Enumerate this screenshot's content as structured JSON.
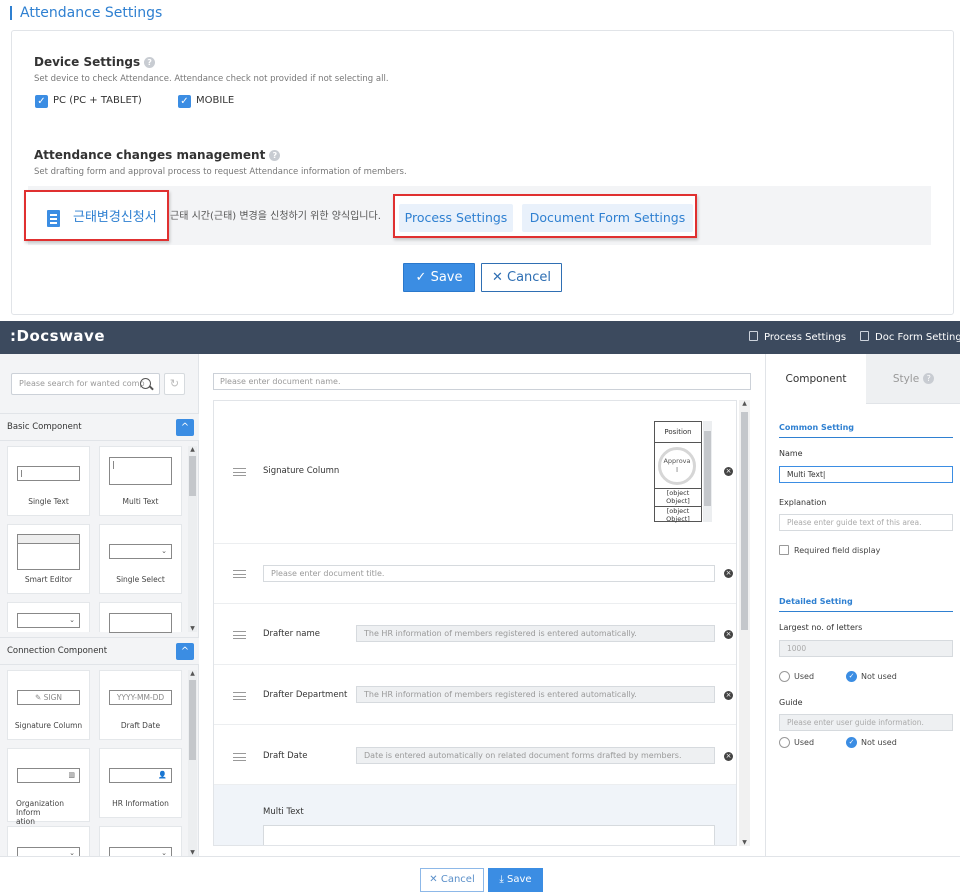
{
  "attendance": {
    "title": "Attendance Settings",
    "device": {
      "title": "Device Settings",
      "help": "?",
      "desc": "Set device to check Attendance. Attendance check not provided if not selecting all.",
      "options": [
        {
          "label": "PC (PC + TABLET)",
          "checked": true
        },
        {
          "label": "MOBILE",
          "checked": true
        }
      ]
    },
    "changes": {
      "title": "Attendance changes management",
      "help": "?",
      "desc": "Set drafting form and approval process to request Attendance information of members.",
      "form_name": "근태변경신청서",
      "form_desc": "근태 시간(근태) 변경을 신청하기 위한 양식입니다.",
      "process_settings": "Process Settings",
      "document_form_settings": "Document Form Settings"
    },
    "save_label": "Save",
    "cancel_label": "Cancel",
    "check_glyph": "✓",
    "x_glyph": "✕"
  },
  "docswave": {
    "logo": ":Docswave",
    "nav": {
      "process_settings": "Process Settings",
      "doc_form_settings": "Doc Form Settings"
    },
    "left": {
      "search_placeholder": "Please search for wanted comp",
      "refresh_glyph": "↻",
      "collapse_glyph": "^",
      "basic_group": "Basic Component",
      "basic_items": [
        "Single Text",
        "Multi Text",
        "Smart Editor",
        "Single Select"
      ],
      "connection_group": "Connection Component",
      "connection_items": [
        "Signature Column",
        "Draft Date",
        "Organization Inform\nation",
        "HR Information"
      ],
      "sign_text": "SIGN",
      "date_text": "YYYY-MM-DD"
    },
    "center": {
      "docname_placeholder": "Please enter document name.",
      "rows": {
        "signature": "Signature Column",
        "title_placeholder": "Please enter document title.",
        "drafter_name": "Drafter name",
        "drafter_name_value": "The HR information of members registered is entered automatically.",
        "drafter_dept": "Drafter Department",
        "drafter_dept_value": "The HR information of members registered is entered automatically.",
        "draft_date": "Draft Date",
        "draft_date_value": "Date is entered automatically on related document forms drafted by members.",
        "multi_text": "Multi Text"
      },
      "sig": {
        "position": "Position",
        "approval": "Approva\nl",
        "obj1": "[object\nObject]",
        "obj2": "[object\nObject]"
      },
      "delete_glyph": "×"
    },
    "right": {
      "tab_component": "Component",
      "tab_style": "Style",
      "common_setting": "Common Setting",
      "name_label": "Name",
      "name_value": "Multi Text",
      "explanation_label": "Explanation",
      "explanation_placeholder": "Please enter guide text of this area.",
      "required_label": "Required field display",
      "detailed_setting": "Detailed Setting",
      "largest_label": "Largest no. of letters",
      "largest_value": "1000",
      "used": "Used",
      "not_used": "Not used",
      "guide_label": "Guide",
      "guide_placeholder": "Please enter user guide information."
    },
    "bottom": {
      "cancel": "Cancel",
      "save": "Save",
      "x_glyph": "✕",
      "save_glyph": "⤓"
    }
  },
  "colors": {
    "accent": "#3b8de3",
    "header": "#3c4a5e",
    "highlight": "#e03030"
  }
}
